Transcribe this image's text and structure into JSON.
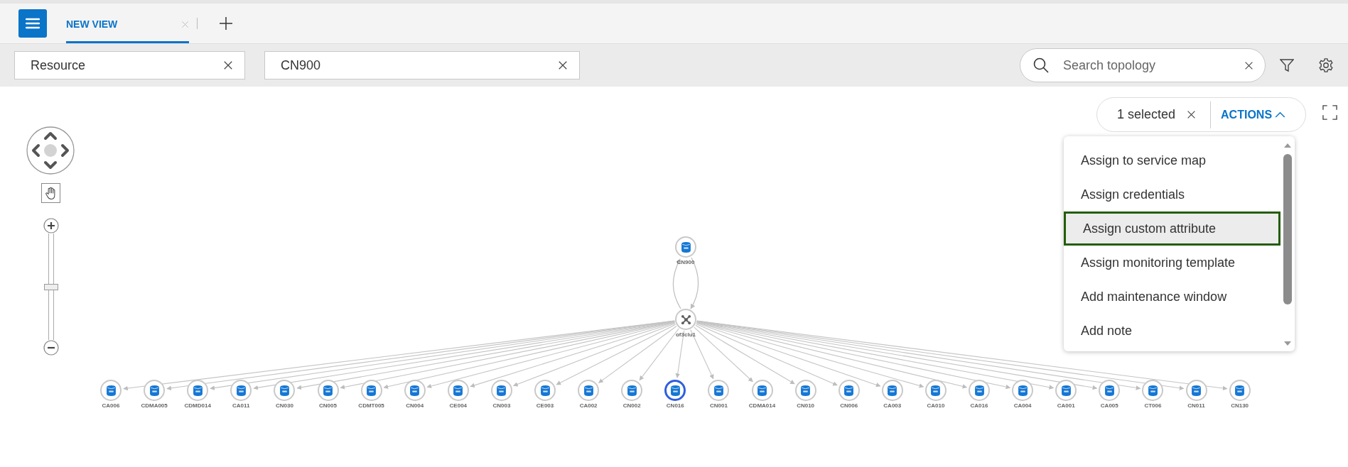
{
  "tabs": [
    {
      "label": "NEW VIEW",
      "selected": true
    }
  ],
  "filters": [
    {
      "value": "Resource"
    },
    {
      "value": "CN900"
    }
  ],
  "search": {
    "placeholder": "Search topology"
  },
  "selection": {
    "count_label": "1 selected",
    "actions_label": "ACTIONS",
    "expanded": true
  },
  "actions_menu": [
    {
      "label": "Assign to service map",
      "selected": false
    },
    {
      "label": "Assign credentials",
      "selected": false
    },
    {
      "label": "Assign custom attribute",
      "selected": true
    },
    {
      "label": "Assign monitoring template",
      "selected": false
    },
    {
      "label": "Add maintenance window",
      "selected": false
    },
    {
      "label": "Add note",
      "selected": false
    }
  ],
  "zoom": {
    "level": 0.5
  },
  "graph": {
    "top": {
      "label": "CN900",
      "kind": "database",
      "selected": false
    },
    "hub": {
      "label": "of3clu1",
      "kind": "cluster",
      "selected": false
    },
    "leaves": [
      {
        "label": "CA006",
        "kind": "database",
        "selected": false
      },
      {
        "label": "CDMA005",
        "kind": "database",
        "selected": false
      },
      {
        "label": "CDMD014",
        "kind": "database",
        "selected": false
      },
      {
        "label": "CA011",
        "kind": "database",
        "selected": false
      },
      {
        "label": "CN030",
        "kind": "database",
        "selected": false
      },
      {
        "label": "CN005",
        "kind": "database",
        "selected": false
      },
      {
        "label": "CDMT005",
        "kind": "database",
        "selected": false
      },
      {
        "label": "CN004",
        "kind": "database",
        "selected": false
      },
      {
        "label": "CE004",
        "kind": "database",
        "selected": false
      },
      {
        "label": "CN003",
        "kind": "database",
        "selected": false
      },
      {
        "label": "CE003",
        "kind": "database",
        "selected": false
      },
      {
        "label": "CA002",
        "kind": "database",
        "selected": false
      },
      {
        "label": "CN002",
        "kind": "database",
        "selected": false
      },
      {
        "label": "CN016",
        "kind": "database",
        "selected": true
      },
      {
        "label": "CN001",
        "kind": "database",
        "selected": false
      },
      {
        "label": "CDMA014",
        "kind": "database",
        "selected": false
      },
      {
        "label": "CN010",
        "kind": "database",
        "selected": false
      },
      {
        "label": "CN006",
        "kind": "database",
        "selected": false
      },
      {
        "label": "CA003",
        "kind": "database",
        "selected": false
      },
      {
        "label": "CA010",
        "kind": "database",
        "selected": false
      },
      {
        "label": "CA016",
        "kind": "database",
        "selected": false
      },
      {
        "label": "CA004",
        "kind": "database",
        "selected": false
      },
      {
        "label": "CA001",
        "kind": "database",
        "selected": false
      },
      {
        "label": "CA005",
        "kind": "database",
        "selected": false
      },
      {
        "label": "CT006",
        "kind": "database",
        "selected": false
      },
      {
        "label": "CN011",
        "kind": "database",
        "selected": false
      },
      {
        "label": "CN130",
        "kind": "database",
        "selected": false
      }
    ]
  }
}
